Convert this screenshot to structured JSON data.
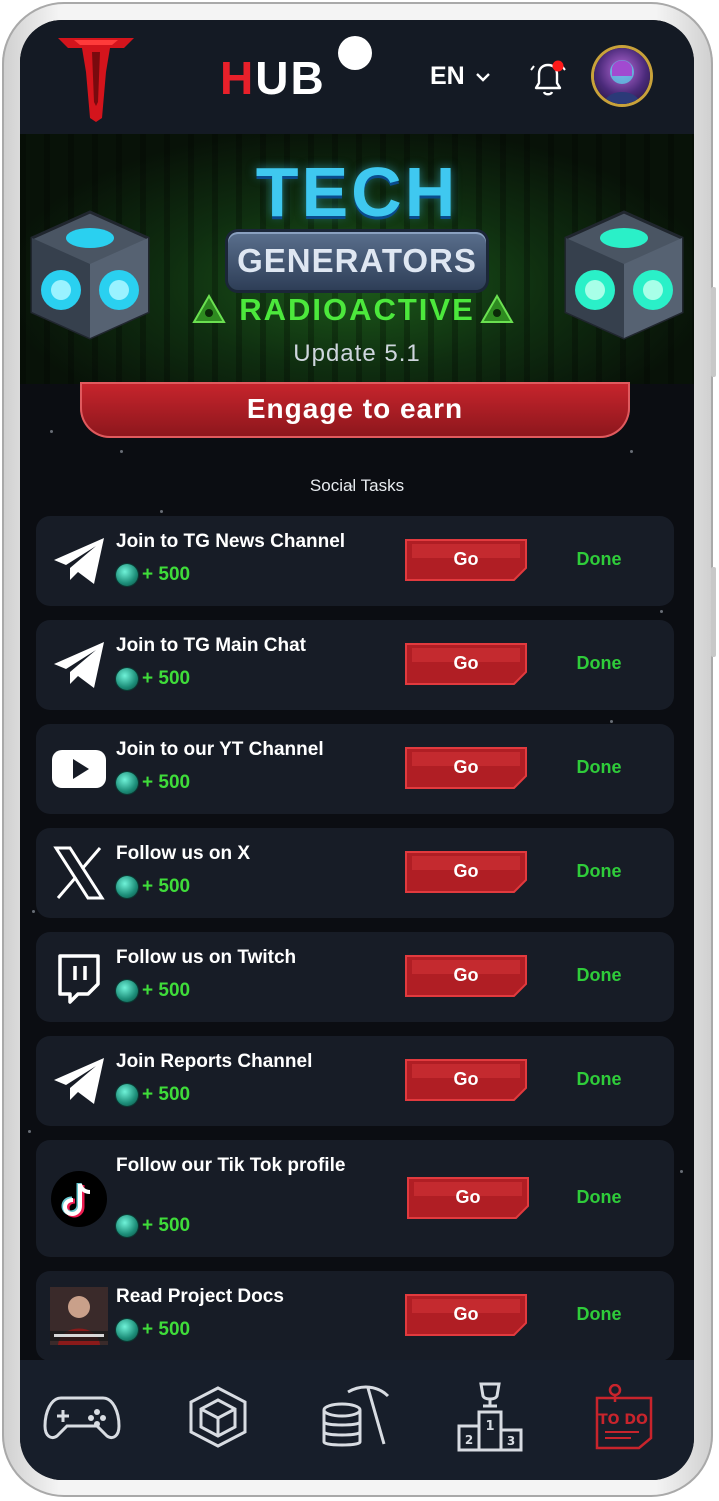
{
  "header": {
    "brand_h": "H",
    "brand_rest": "UB",
    "language": "EN",
    "icons": [
      "logo-icon",
      "chevron-down-icon",
      "bell-icon",
      "avatar"
    ]
  },
  "banner": {
    "title": "TECH",
    "subtitle": "GENERATORS",
    "tag": "RADIOACTIVE",
    "update": "Update 5.1"
  },
  "engage_label": "Engage to earn",
  "section_title": "Social Tasks",
  "tasks": [
    {
      "title": "Join to TG News Channel",
      "reward": "+ 500",
      "go": "Go",
      "status": "Done",
      "icon": "telegram-icon"
    },
    {
      "title": "Join to TG Main Chat",
      "reward": "+ 500",
      "go": "Go",
      "status": "Done",
      "icon": "telegram-icon"
    },
    {
      "title": "Join to our YT Channel",
      "reward": "+ 500",
      "go": "Go",
      "status": "Done",
      "icon": "youtube-icon"
    },
    {
      "title": "Follow us on X",
      "reward": "+ 500",
      "go": "Go",
      "status": "Done",
      "icon": "x-icon"
    },
    {
      "title": "Follow us on Twitch",
      "reward": "+ 500",
      "go": "Go",
      "status": "Done",
      "icon": "twitch-icon"
    },
    {
      "title": "Join Reports Channel",
      "reward": "+ 500",
      "go": "Go",
      "status": "Done",
      "icon": "telegram-icon"
    },
    {
      "title": "Follow our Tik Tok profile",
      "reward": "+ 500",
      "go": "Go",
      "status": "Done",
      "icon": "tiktok-icon"
    },
    {
      "title": "Read Project Docs",
      "reward": "+ 500",
      "go": "Go",
      "status": "Done",
      "icon": "docs-thumbnail"
    }
  ],
  "nav": {
    "items": [
      "gamepad-icon",
      "cube-icon",
      "mining-icon",
      "leaderboard-icon",
      "todo-icon"
    ],
    "todo_label": "TO DO",
    "podium_numbers": [
      "1",
      "2",
      "3"
    ]
  },
  "colors": {
    "accent_red": "#c8252d",
    "done_green": "#2fcc3a",
    "reward_green": "#3fdc3a",
    "card_bg": "#171c26"
  }
}
